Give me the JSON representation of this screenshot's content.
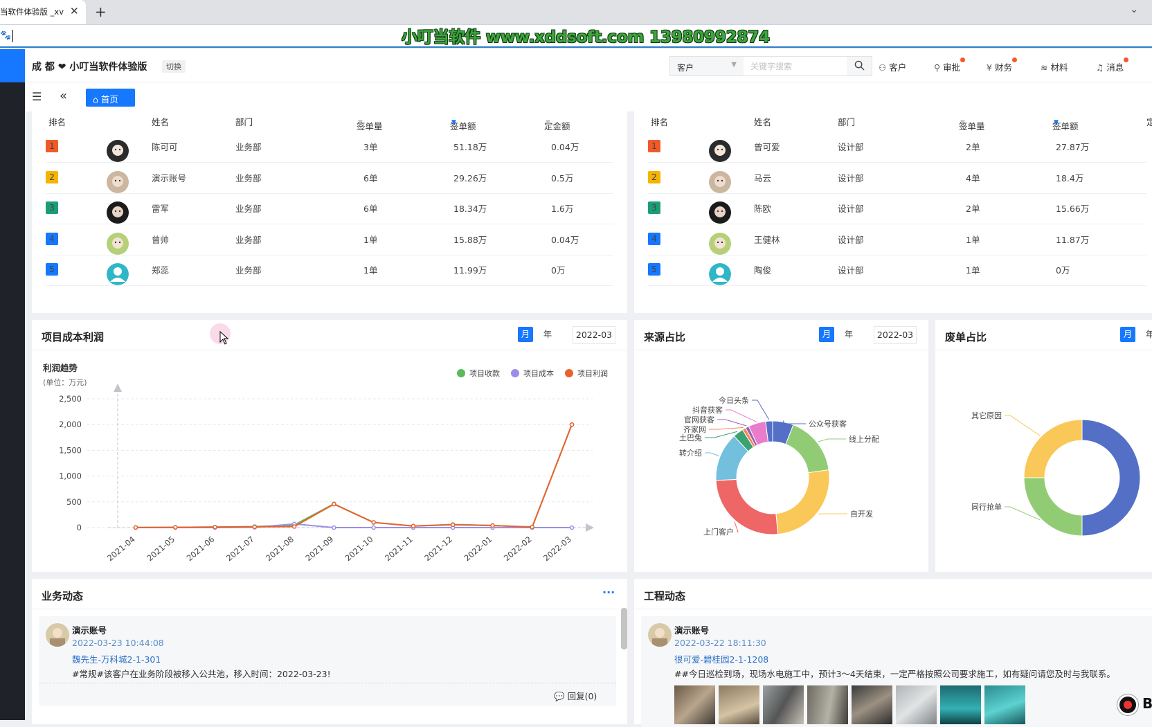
{
  "browser": {
    "tab_title": "当软件体验版 _xv",
    "tab_close": "✕",
    "new_tab": "+",
    "tab_menu": "⌄"
  },
  "watermark": "小叮当软件 www.xddsoft.com 13980992874",
  "topbar": {
    "brand": "成 都 ❤ 小叮当软件体验版",
    "switch": "切换",
    "search_type": "客户",
    "search_placeholder": "关键字搜索",
    "nav": [
      {
        "label": "客户",
        "icon": "user-icon",
        "dot": false
      },
      {
        "label": "审批",
        "icon": "stamp-icon",
        "dot": true
      },
      {
        "label": "财务",
        "icon": "finance-icon",
        "dot": true
      },
      {
        "label": "材料",
        "icon": "layers-icon",
        "dot": false
      },
      {
        "label": "消息",
        "icon": "bell-icon",
        "dot": true
      }
    ]
  },
  "subbar": {
    "home_tab": "首页"
  },
  "rank_left": {
    "headers": [
      "排名",
      "姓名",
      "部门",
      "签单量",
      "签单额",
      "定金额"
    ],
    "rows": [
      {
        "rank": "1",
        "name": "陈可可",
        "dept": "业务部",
        "count": "3单",
        "amount": "51.18万",
        "deposit": "0.04万"
      },
      {
        "rank": "2",
        "name": "演示账号",
        "dept": "业务部",
        "count": "6单",
        "amount": "29.26万",
        "deposit": "0.5万"
      },
      {
        "rank": "3",
        "name": "雷军",
        "dept": "业务部",
        "count": "6单",
        "amount": "18.34万",
        "deposit": "1.6万"
      },
      {
        "rank": "4",
        "name": "曾帅",
        "dept": "业务部",
        "count": "1单",
        "amount": "15.88万",
        "deposit": "0.04万"
      },
      {
        "rank": "5",
        "name": "郑蕊",
        "dept": "业务部",
        "count": "1单",
        "amount": "11.99万",
        "deposit": "0万"
      }
    ]
  },
  "rank_right": {
    "headers": [
      "排名",
      "姓名",
      "部门",
      "签单量",
      "签单额",
      "定"
    ],
    "rows": [
      {
        "rank": "1",
        "name": "曾可爱",
        "dept": "设计部",
        "count": "2单",
        "amount": "27.87万"
      },
      {
        "rank": "2",
        "name": "马云",
        "dept": "设计部",
        "count": "4单",
        "amount": "18.4万"
      },
      {
        "rank": "3",
        "name": "陈欧",
        "dept": "设计部",
        "count": "2单",
        "amount": "15.66万"
      },
      {
        "rank": "4",
        "name": "王健林",
        "dept": "设计部",
        "count": "1单",
        "amount": "11.87万"
      },
      {
        "rank": "5",
        "name": "陶俊",
        "dept": "设计部",
        "count": "1单",
        "amount": "0万"
      }
    ]
  },
  "rank_colors": [
    "#f05a28",
    "#f5b400",
    "#1b9e77",
    "#1677ff",
    "#1677ff"
  ],
  "profit_panel": {
    "title": "项目成本利润",
    "month": "月",
    "year": "年",
    "date": "2022-03"
  },
  "source_panel": {
    "title": "来源占比",
    "month": "月",
    "year": "年",
    "date": "2022-03"
  },
  "waste_panel": {
    "title": "废单占比",
    "month": "月",
    "year": "年"
  },
  "chart_data": [
    {
      "type": "line",
      "title": "利润趋势",
      "subtitle": "(单位：万元)",
      "x": [
        "2021-04",
        "2021-05",
        "2021-06",
        "2021-07",
        "2021-08",
        "2021-09",
        "2021-10",
        "2021-11",
        "2021-12",
        "2022-01",
        "2022-02",
        "2022-03"
      ],
      "ylim": [
        0,
        2500
      ],
      "yticks": [
        "0",
        "500",
        "1,000",
        "1,500",
        "2,000",
        "2,500"
      ],
      "legend_position": "top-right",
      "grid": true,
      "series": [
        {
          "name": "项目收款",
          "color": "#5cb85c",
          "values": [
            2,
            5,
            10,
            20,
            50,
            460,
            100,
            30,
            60,
            40,
            10,
            2000
          ]
        },
        {
          "name": "项目成本",
          "color": "#9a8fe8",
          "values": [
            0,
            0,
            0,
            5,
            70,
            0,
            0,
            0,
            0,
            0,
            0,
            0
          ]
        },
        {
          "name": "项目利润",
          "color": "#e9622e",
          "values": [
            2,
            5,
            10,
            15,
            20,
            455,
            100,
            30,
            55,
            40,
            10,
            2000
          ]
        }
      ]
    },
    {
      "type": "pie",
      "title": "来源占比",
      "donut": true,
      "slices": [
        {
          "label": "公众号获客",
          "value": 6,
          "color": "#5470c6"
        },
        {
          "label": "线上分配",
          "value": 17,
          "color": "#91cc75"
        },
        {
          "label": "自开发",
          "value": 26,
          "color": "#fac858"
        },
        {
          "label": "上门客户",
          "value": 26,
          "color": "#ee6666"
        },
        {
          "label": "转介绍",
          "value": 14,
          "color": "#73c0de"
        },
        {
          "label": "土巴兔",
          "value": 3,
          "color": "#3ba272"
        },
        {
          "label": "齐家网",
          "value": 1,
          "color": "#fc8452"
        },
        {
          "label": "官网获客",
          "value": 1,
          "color": "#9a60b4"
        },
        {
          "label": "抖音获客",
          "value": 5,
          "color": "#ea7ccc"
        },
        {
          "label": "今日头条",
          "value": 2,
          "color": "#5470c6"
        }
      ]
    },
    {
      "type": "pie",
      "title": "废单占比",
      "donut": true,
      "slices": [
        {
          "label": "",
          "value": 50,
          "color": "#5470c6"
        },
        {
          "label": "同行抢单",
          "value": 25,
          "color": "#91cc75"
        },
        {
          "label": "其它原因",
          "value": 25,
          "color": "#fac858"
        }
      ]
    }
  ],
  "business_feed": {
    "title": "业务动态",
    "more": "···",
    "item": {
      "name": "演示账号",
      "time": "2022-03-23 10:44:08",
      "link": "魏先生-万科城2-1-301",
      "text": "#常规#该客户在业务阶段被移入公共池，移入时间：2022-03-23!",
      "reply": "回复(0)"
    }
  },
  "project_feed": {
    "title": "工程动态",
    "item": {
      "name": "演示账号",
      "time": "2022-03-22 18:11:30",
      "link": "很可爱-碧桂园2-1-1208",
      "text": "##今日巡检到场，现场水电施工中，预计3～4天结束，一定严格按照公司要求施工，如有疑问请您及时与我联系。"
    }
  },
  "recorder_label": "B"
}
